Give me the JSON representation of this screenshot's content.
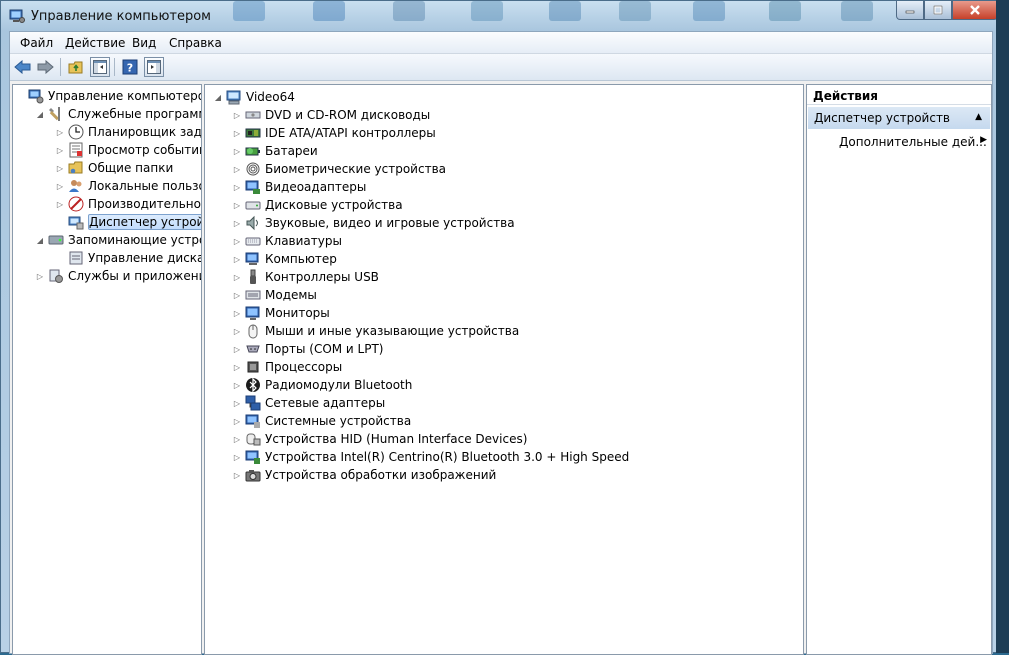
{
  "window": {
    "title": "Управление компьютером"
  },
  "menu": [
    "Файл",
    "Действие",
    "Вид",
    "Справка"
  ],
  "left_tree": [
    {
      "label": "Управление компьютером (л",
      "level": 0,
      "expander": "",
      "icon": "computer-management-icon"
    },
    {
      "label": "Служебные программы",
      "level": 1,
      "expander": "◢",
      "icon": "tools-icon"
    },
    {
      "label": "Планировщик заданий",
      "level": 2,
      "expander": "▷",
      "icon": "clock-icon"
    },
    {
      "label": "Просмотр событий",
      "level": 2,
      "expander": "▷",
      "icon": "event-viewer-icon"
    },
    {
      "label": "Общие папки",
      "level": 2,
      "expander": "▷",
      "icon": "shared-folder-icon"
    },
    {
      "label": "Локальные пользовате",
      "level": 2,
      "expander": "▷",
      "icon": "users-icon"
    },
    {
      "label": "Производительность",
      "level": 2,
      "expander": "▷",
      "icon": "performance-icon"
    },
    {
      "label": "Диспетчер устройств",
      "level": 2,
      "expander": "",
      "icon": "device-manager-icon",
      "selected": true
    },
    {
      "label": "Запоминающие устройст",
      "level": 1,
      "expander": "◢",
      "icon": "storage-icon"
    },
    {
      "label": "Управление дисками",
      "level": 2,
      "expander": "",
      "icon": "disk-management-icon"
    },
    {
      "label": "Службы и приложения",
      "level": 1,
      "expander": "▷",
      "icon": "services-icon"
    }
  ],
  "device_tree": {
    "root": "Video64",
    "categories": [
      {
        "label": "DVD и CD-ROM дисководы",
        "icon": "dvd-drive-icon"
      },
      {
        "label": "IDE ATA/ATAPI контроллеры",
        "icon": "ide-controller-icon"
      },
      {
        "label": "Батареи",
        "icon": "battery-icon"
      },
      {
        "label": "Биометрические устройства",
        "icon": "fingerprint-icon"
      },
      {
        "label": "Видеоадаптеры",
        "icon": "display-adapter-icon"
      },
      {
        "label": "Дисковые устройства",
        "icon": "disk-drive-icon"
      },
      {
        "label": "Звуковые, видео и игровые устройства",
        "icon": "speaker-icon"
      },
      {
        "label": "Клавиатуры",
        "icon": "keyboard-icon"
      },
      {
        "label": "Компьютер",
        "icon": "computer-icon"
      },
      {
        "label": "Контроллеры USB",
        "icon": "usb-icon"
      },
      {
        "label": "Модемы",
        "icon": "modem-icon"
      },
      {
        "label": "Мониторы",
        "icon": "monitor-icon"
      },
      {
        "label": "Мыши и иные указывающие устройства",
        "icon": "mouse-icon"
      },
      {
        "label": "Порты (COM и LPT)",
        "icon": "port-icon"
      },
      {
        "label": "Процессоры",
        "icon": "processor-icon"
      },
      {
        "label": "Радиомодули Bluetooth",
        "icon": "bluetooth-icon"
      },
      {
        "label": "Сетевые адаптеры",
        "icon": "network-adapter-icon"
      },
      {
        "label": "Системные устройства",
        "icon": "system-devices-icon"
      },
      {
        "label": "Устройства HID (Human Interface Devices)",
        "icon": "hid-icon"
      },
      {
        "label": "Устройства Intel(R) Centrino(R) Bluetooth 3.0 + High Speed",
        "icon": "intel-bluetooth-icon"
      },
      {
        "label": "Устройства обработки изображений",
        "icon": "imaging-device-icon"
      }
    ]
  },
  "actions": {
    "header": "Действия",
    "section": "Диспетчер устройств",
    "item": "Дополнительные дей..."
  }
}
